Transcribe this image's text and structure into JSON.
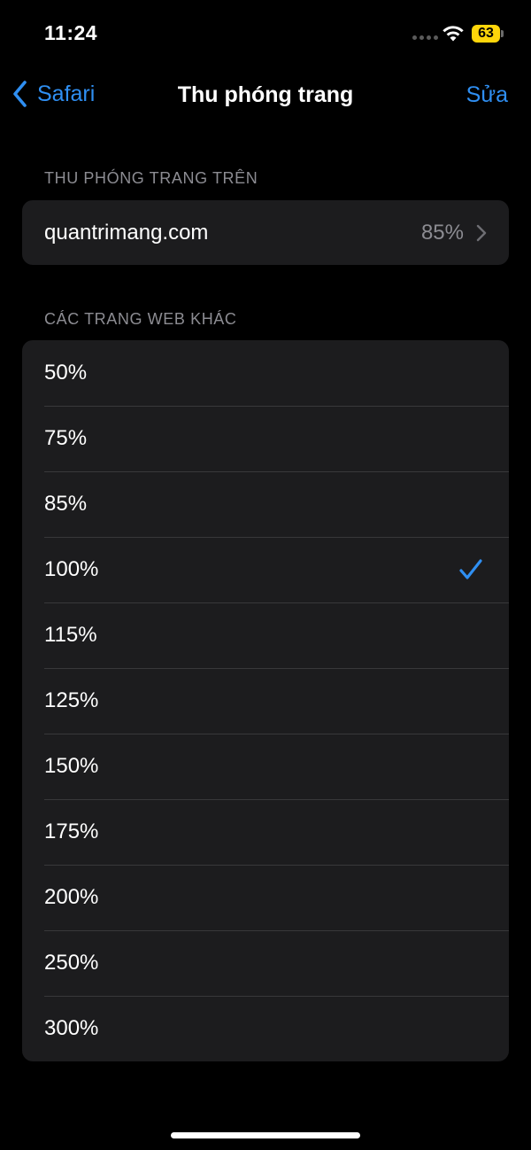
{
  "status_bar": {
    "time": "11:24",
    "battery_level": "63",
    "battery_color": "#ffd60a"
  },
  "nav": {
    "back_label": "Safari",
    "title": "Thu phóng trang",
    "edit_label": "Sửa"
  },
  "site_section": {
    "header": "THU PHÓNG TRANG TRÊN",
    "site": "quantrimang.com",
    "value": "85%"
  },
  "other_section": {
    "header": "CÁC TRANG WEB KHÁC",
    "options": [
      "50%",
      "75%",
      "85%",
      "100%",
      "115%",
      "125%",
      "150%",
      "175%",
      "200%",
      "250%",
      "300%"
    ],
    "selected": "100%"
  },
  "colors": {
    "accent": "#2f8ff2",
    "group_bg": "#1c1c1e",
    "secondary_text": "#8c8c92"
  },
  "icons": [
    "wifi-icon",
    "chevron-left-icon",
    "chevron-right-icon",
    "checkmark-icon"
  ]
}
